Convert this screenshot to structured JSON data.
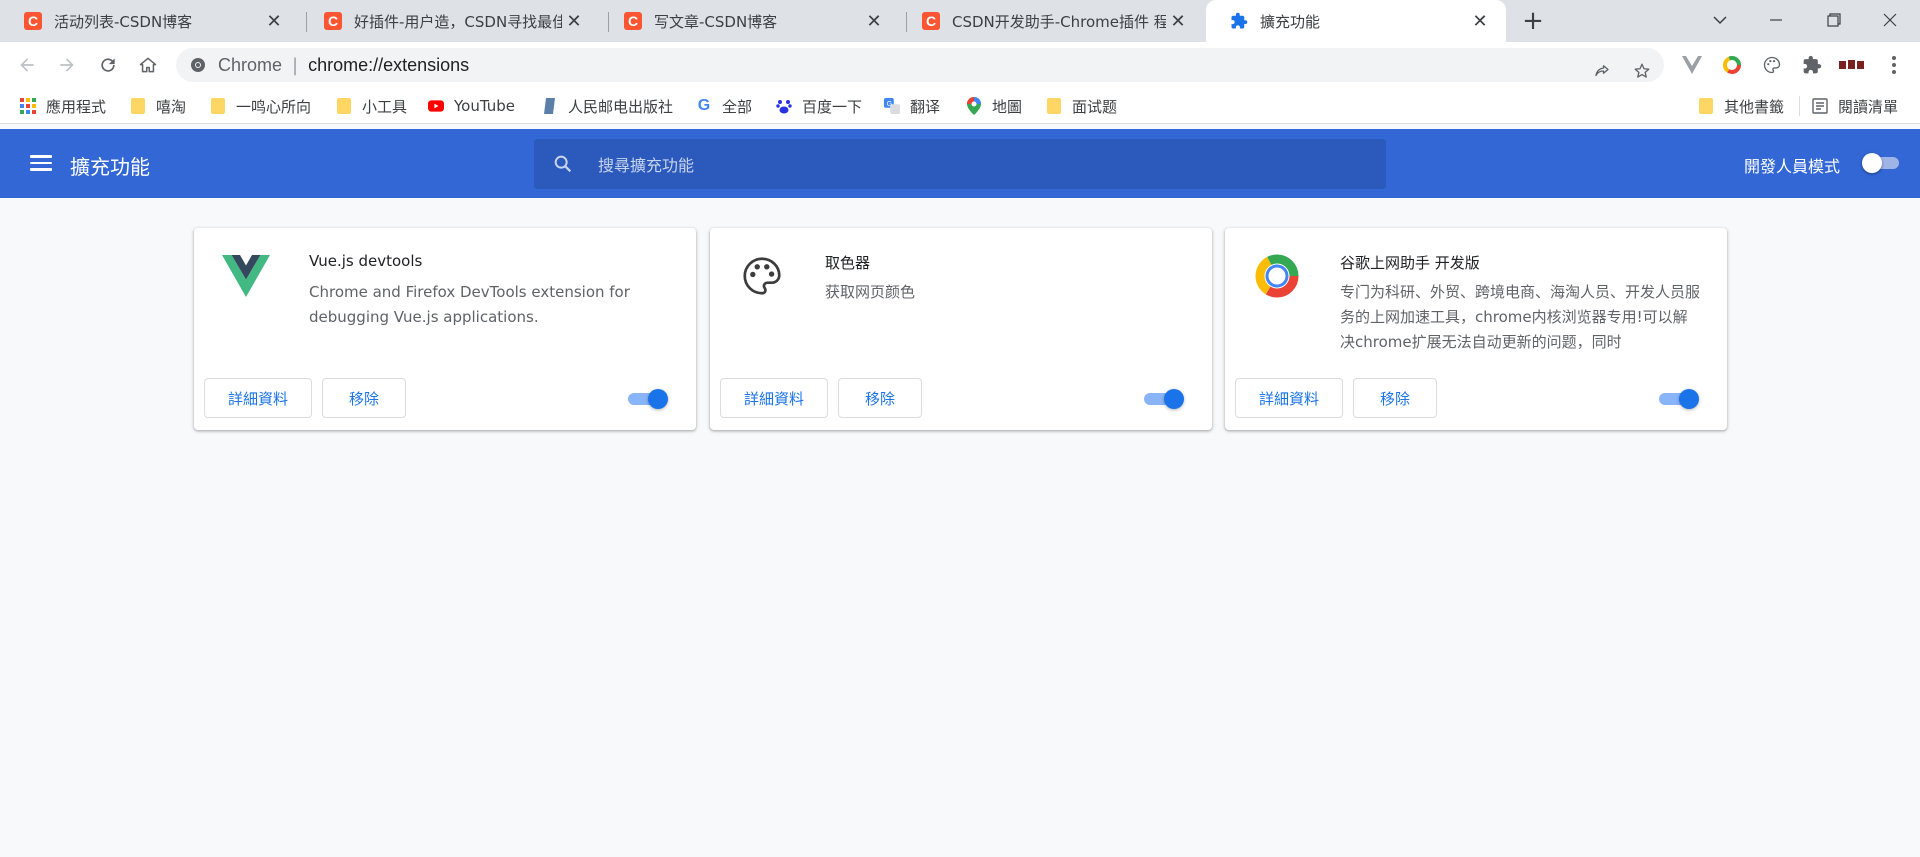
{
  "tabs": [
    {
      "title": "活动列表-CSDN博客",
      "icon": "csdn-icon"
    },
    {
      "title": "好插件-用户造，CSDN寻找最佳万",
      "icon": "csdn-icon"
    },
    {
      "title": "写文章-CSDN博客",
      "icon": "csdn-icon"
    },
    {
      "title": "CSDN开发助手-Chrome插件 程",
      "icon": "csdn-icon"
    },
    {
      "title": "擴充功能",
      "icon": "puzzle-icon",
      "active": true
    }
  ],
  "omnibox": {
    "origin": "Chrome",
    "url": "chrome://extensions"
  },
  "bookmarks": {
    "items": [
      {
        "label": "應用程式",
        "icon": "apps-grid-icon"
      },
      {
        "label": "嘻淘",
        "icon": "folder-icon"
      },
      {
        "label": "一鸣心所向",
        "icon": "folder-icon"
      },
      {
        "label": "小工具",
        "icon": "folder-icon"
      },
      {
        "label": "YouTube",
        "icon": "youtube-icon"
      },
      {
        "label": "人民邮电出版社",
        "icon": "book-icon"
      },
      {
        "label": "全部",
        "icon": "google-icon"
      },
      {
        "label": "百度一下",
        "icon": "baidu-icon"
      },
      {
        "label": "翻译",
        "icon": "translate-icon"
      },
      {
        "label": "地圖",
        "icon": "maps-icon"
      },
      {
        "label": "面试题",
        "icon": "folder-icon"
      }
    ],
    "other": "其他書籤",
    "reading_list": "閱讀清單"
  },
  "header": {
    "title": "擴充功能",
    "search_placeholder": "搜尋擴充功能",
    "dev_mode_label": "開發人員模式",
    "dev_mode_on": false
  },
  "extensions": [
    {
      "name": "Vue.js devtools",
      "description": "Chrome and Firefox DevTools extension for debugging Vue.js applications.",
      "details_label": "詳細資料",
      "remove_label": "移除",
      "enabled": true,
      "icon": "vue-logo-icon"
    },
    {
      "name": "取色器",
      "description": "获取网页颜色",
      "details_label": "詳細資料",
      "remove_label": "移除",
      "enabled": true,
      "icon": "palette-icon"
    },
    {
      "name": "谷歌上网助手 开发版",
      "description": "专门为科研、外贸、跨境电商、海淘人员、开发人员服务的上网加速工具，chrome内核浏览器专用!可以解决chrome扩展无法自动更新的问题，同时",
      "details_label": "詳細資料",
      "remove_label": "移除",
      "enabled": true,
      "icon": "ring-logo-icon"
    }
  ],
  "colors": {
    "header_bg": "#3367d6",
    "search_bg": "#2b59bc",
    "accent": "#1a73e8",
    "csdn": "#fc5531"
  }
}
